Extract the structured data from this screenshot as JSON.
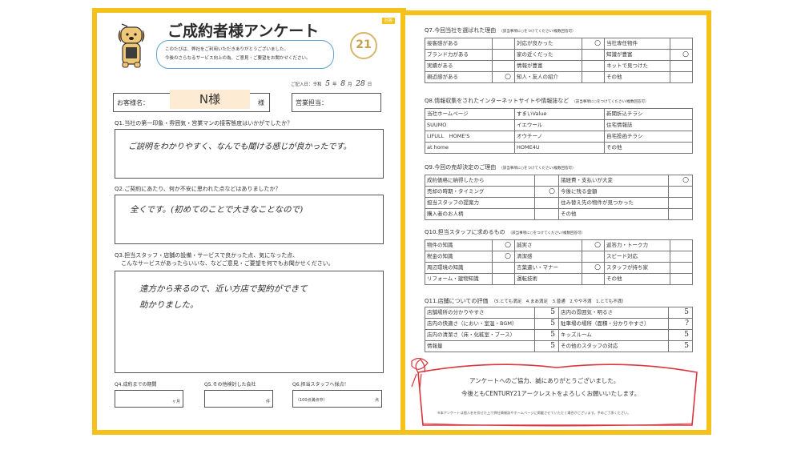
{
  "left": {
    "corner_tag": "回答",
    "title": "ご成約者様アンケート",
    "intro_lines": [
      "このたびは、弊社をご利用いただきありがとうございました。",
      "今後のさらなるサービス向上の為、ご意見・ご要望をお聞かせください。"
    ],
    "logo_text": "21",
    "date_label": "ご記入日：令和",
    "date_year": "5",
    "date_y_unit": "年",
    "date_month": "8",
    "date_m_unit": "月",
    "date_day": "28",
    "date_d_unit": "日",
    "customer_label": "お客様名：",
    "customer_name": "N様",
    "customer_suffix": "様",
    "staff_label": "営業担当：",
    "q1": "Q1.当社の第一印象・雰囲気・営業マンの接客態度はいかがでしたか？",
    "q1_answer": "ご説明をわかりやすく、なんでも聞ける感じが良かったです。",
    "q2": "Q2.ご契約にあたり、何か不安に思われた点などはありましたか？",
    "q2_answer": "全くです。(初めてのことで大きなことなので)",
    "q3_lines": [
      "Q3.担当スタッフ・店舗の設備・サービスで良かった点、気になった点、",
      "こんなサービスがあったらいいな、などご意見・ご要望を何でもお聞かせください。"
    ],
    "q3_answer": [
      "遠方から来るので、近い方店で契約ができて",
      "助かりました。"
    ],
    "q4": "Q4.成約までの期間",
    "q4_unit": "ヶ月",
    "q5": "Q5.その他検討した会社",
    "q5_unit": "件",
    "q6": "Q6.担当スタッフへ採点！",
    "q6_unit": "（100点満点中）",
    "q6_point": "点"
  },
  "right": {
    "q7": "Q7.今回当社を選ばれた理由",
    "q7_note": "（該当事項に○をつけてください/複数回答可）",
    "q7_rows": [
      [
        "接客感がある",
        "",
        "対応が良かった",
        "○",
        "当社専任物件",
        ""
      ],
      [
        "ブランド力がある",
        "",
        "家の近くだった",
        "",
        "知識が豊富",
        "○"
      ],
      [
        "実績がある",
        "",
        "情報が豊富",
        "",
        "ネットで見つけた",
        ""
      ],
      [
        "親近感がある",
        "○",
        "知人・友人の紹介",
        "",
        "その他",
        ""
      ]
    ],
    "q8": "Q8.情報収集をされたインターネットサイトや情報誌など",
    "q8_note": "（該当事項に○をつけてください/複数回答可）",
    "q8_rows": [
      [
        "当社ホームページ",
        "すまいValue",
        "新聞折込チラシ"
      ],
      [
        "SUUMO",
        "イエウール",
        "住宅情報誌"
      ],
      [
        "LIFULL　HOME'S",
        "オウチーノ",
        "自宅投函チラシ"
      ],
      [
        "at home",
        "HOME4U",
        "その他"
      ]
    ],
    "q9": "Q9.今回の売却決定のご理由",
    "q9_note": "（該当事項に○をつけてください/複数回答可）",
    "q9_rows": [
      [
        "成約価格に納得したから",
        "",
        "諸経費・支払いが大変",
        "○"
      ],
      [
        "売却の時期・タイミング",
        "○",
        "今後に残る金額",
        ""
      ],
      [
        "担当スタッフの提案力",
        "",
        "住み替え先の物件が見つかった",
        ""
      ],
      [
        "購入者のお人柄",
        "",
        "その他",
        ""
      ]
    ],
    "q10": "Q10.担当スタッフに求めるもの",
    "q10_note": "（該当事項に○をつけてください/複数回答可）",
    "q10_rows": [
      [
        "物件の知識",
        "○",
        "誠実さ",
        "○",
        "返答力・トーク力",
        ""
      ],
      [
        "税金の知識",
        "○",
        "清潔感",
        "",
        "スピード対応",
        ""
      ],
      [
        "周辺環境の知識",
        "",
        "言葉遣い・マナー",
        "○",
        "スタッフが持ち家",
        ""
      ],
      [
        "リフォーム・建物知識",
        "",
        "運転技術",
        "",
        "その他",
        ""
      ]
    ],
    "q11": "Q11.店舗についての評価",
    "q11_scale": "（5.とても満足　4.まあ満足　3.普通　2.やや不満　1.とても不満）",
    "q11_rows": [
      [
        "店舗場所の分かりやすさ",
        "5",
        "店内の雰囲気・明るさ",
        "5"
      ],
      [
        "店内の快適さ（におい・室温・BGM）",
        "5",
        "駐車場の場所（面積・分かりやすさ）",
        "?"
      ],
      [
        "店内の清潔さ（床・化粧室・ブース）",
        "5",
        "キッズルーム",
        "5"
      ],
      [
        "情報量",
        "5",
        "その他のスタッフの対応",
        "5"
      ]
    ],
    "thanks_lines": [
      "アンケートへのご協力、誠にありがとうございました。",
      "今後ともCENTURY21アークレストをよろしくお願いいたします。"
    ],
    "footnote": "※本アンケートは個人名を伏せた上で弊社情報誌やホームページに掲載させていただく場合がございます。予めご了承ください。"
  },
  "colors": {
    "frame": "#f5c21b",
    "ribbon": "#d9363e",
    "cell_fill": "#fbf7df",
    "name_highlight": "#fdebd3"
  }
}
